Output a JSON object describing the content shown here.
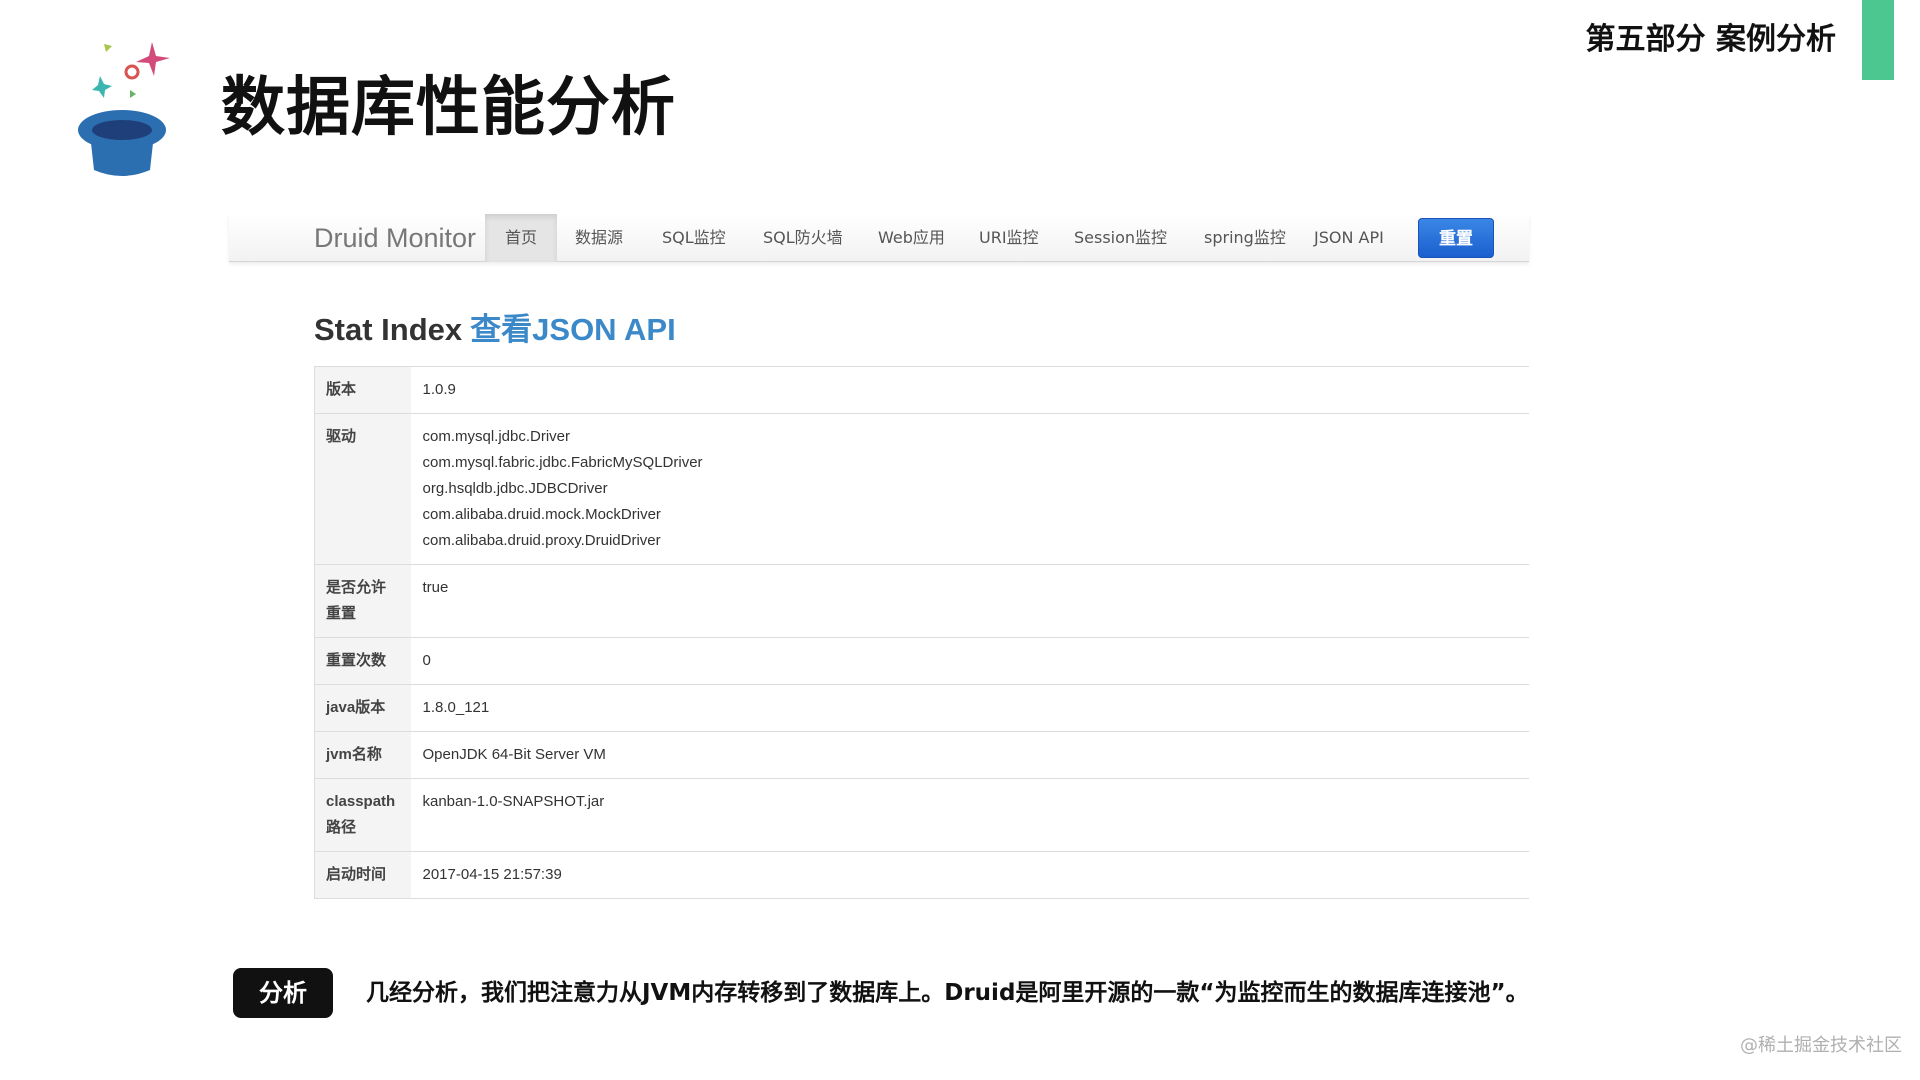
{
  "slide": {
    "title": "数据库性能分析",
    "section": "第五部分 案例分析",
    "accent_color": "#4cc790"
  },
  "monitor": {
    "brand": "Druid Monitor",
    "nav": [
      {
        "label": "首页",
        "active": true
      },
      {
        "label": "数据源"
      },
      {
        "label": "SQL监控"
      },
      {
        "label": "SQL防火墙"
      },
      {
        "label": "Web应用"
      },
      {
        "label": "URI监控"
      },
      {
        "label": "Session监控"
      },
      {
        "label": "spring监控"
      },
      {
        "label": "JSON API"
      }
    ],
    "reset_label": "重置",
    "heading": "Stat Index",
    "heading_link": "查看JSON API",
    "link_color": "#3b89c9",
    "rows": [
      {
        "key": "版本",
        "values": [
          "1.0.9"
        ]
      },
      {
        "key": "驱动",
        "values": [
          "com.mysql.jdbc.Driver",
          "com.mysql.fabric.jdbc.FabricMySQLDriver",
          "org.hsqldb.jdbc.JDBCDriver",
          "com.alibaba.druid.mock.MockDriver",
          "com.alibaba.druid.proxy.DruidDriver"
        ]
      },
      {
        "key": "是否允许重置",
        "values": [
          "true"
        ]
      },
      {
        "key": "重置次数",
        "values": [
          "0"
        ]
      },
      {
        "key": "java版本",
        "values": [
          "1.8.0_121"
        ]
      },
      {
        "key": "jvm名称",
        "values": [
          "OpenJDK 64-Bit Server VM"
        ]
      },
      {
        "key": "classpath路径",
        "values": [
          "kanban-1.0-SNAPSHOT.jar"
        ]
      },
      {
        "key": "启动时间",
        "values": [
          "2017-04-15 21:57:39"
        ]
      }
    ]
  },
  "analysis": {
    "badge": "分析",
    "text": "几经分析，我们把注意力从JVM内存转移到了数据库上。Druid是阿里开源的一款“为监控而生的数据库连接池”。"
  },
  "watermark": "@稀土掘金技术社区"
}
